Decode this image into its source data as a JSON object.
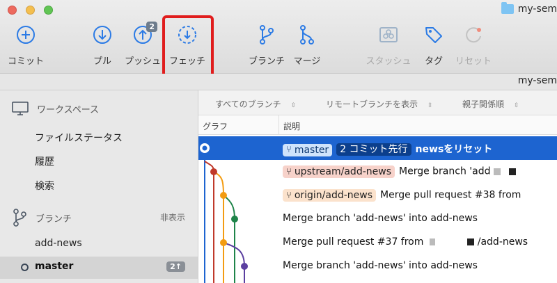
{
  "window": {
    "title": "my-sem"
  },
  "toolbar": {
    "commit_label": "コミット",
    "pull_label": "プル",
    "push_label": "プッシュ",
    "push_badge": "2",
    "fetch_label": "フェッチ",
    "branch_label": "ブランチ",
    "merge_label": "マージ",
    "stash_label": "スタッシュ",
    "tag_label": "タグ",
    "reset_label": "リセット"
  },
  "pathbar": {
    "text": "my-sem"
  },
  "sidebar": {
    "workspace_header": "ワークスペース",
    "workspace_items": [
      "ファイルステータス",
      "履歴",
      "検索"
    ],
    "branch_header": "ブランチ",
    "branch_hide": "非表示",
    "branches": [
      {
        "name": "add-news"
      },
      {
        "name": "master",
        "count": "2↑",
        "current": true
      }
    ]
  },
  "filters": {
    "all_branches": "すべてのブランチ",
    "show_remote": "リモートブランチを表示",
    "parent_order": "親子関係順"
  },
  "columns": {
    "graph": "グラフ",
    "description": "説明"
  },
  "commits": [
    {
      "tag": "master",
      "ahead": "2 コミット先行",
      "message": "newsをリセット"
    },
    {
      "tag": "upstream/add-news",
      "message": "Merge branch 'add"
    },
    {
      "tag": "origin/add-news",
      "message": "Merge pull request #38 from"
    },
    {
      "message": "Merge branch 'add-news' into add-news"
    },
    {
      "message": "Merge pull request #37 from",
      "suffix": "/add-news"
    },
    {
      "message": "Merge branch 'add-news' into add-news"
    }
  ],
  "colors": {
    "selection": "#1d64d0",
    "fetch_highlight": "#e01d1d",
    "graph_blue": "#1d64d0",
    "graph_red": "#c0392b",
    "graph_orange": "#f39c12",
    "graph_green": "#1e8449",
    "graph_purple": "#5b3fa0"
  }
}
